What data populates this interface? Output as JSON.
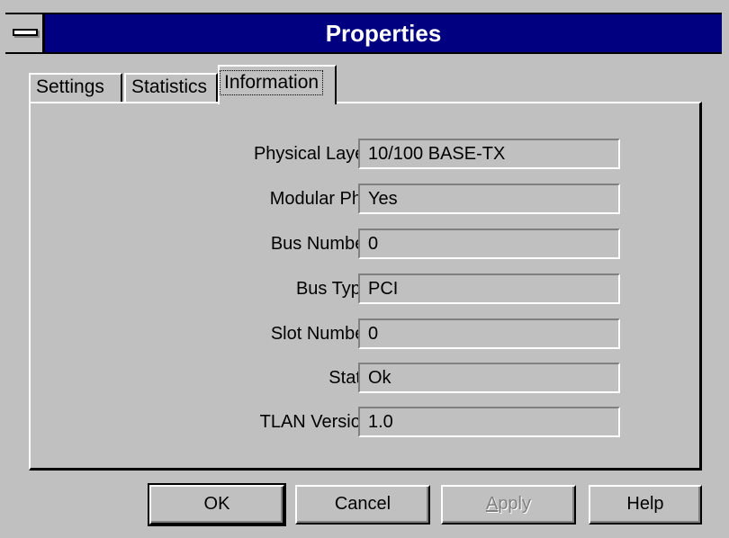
{
  "window": {
    "title": "Properties"
  },
  "tabs": [
    {
      "label": "Settings",
      "active": false
    },
    {
      "label": "Statistics",
      "active": false
    },
    {
      "label": "Information",
      "active": true
    }
  ],
  "info": [
    {
      "label": "Physical Layer",
      "value": "10/100 BASE-TX"
    },
    {
      "label": "Modular Phy",
      "value": "Yes"
    },
    {
      "label": "Bus Number",
      "value": "0"
    },
    {
      "label": "Bus Type",
      "value": "PCI"
    },
    {
      "label": "Slot Number",
      "value": "0"
    },
    {
      "label": "State",
      "value": "Ok"
    },
    {
      "label": "TLAN Version",
      "value": "1.0"
    }
  ],
  "buttons": {
    "ok": "OK",
    "cancel": "Cancel",
    "apply_prefix": "",
    "apply_mnemonic": "A",
    "apply_rest": "pply",
    "help": "Help"
  },
  "colors": {
    "titlebar": "#000080",
    "face": "#c0c0c0",
    "shadow": "#808080"
  }
}
